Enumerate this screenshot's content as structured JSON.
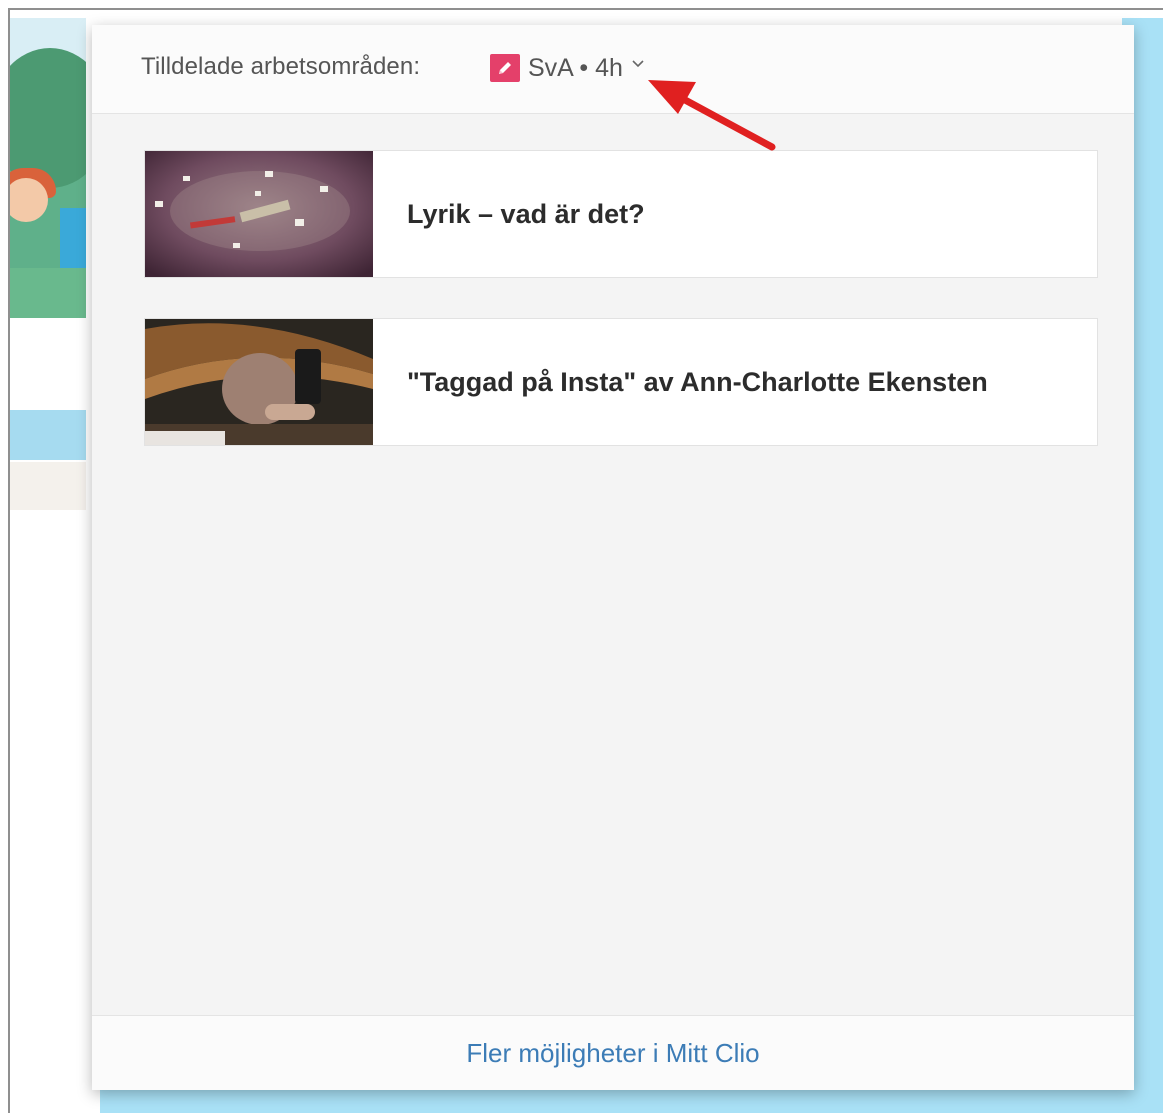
{
  "header": {
    "label": "Tilldelade arbetsområden:",
    "selector_text": "SvA • 4h",
    "selector_icon": "pencil-icon",
    "selector_icon_color": "#e4406a"
  },
  "cards": [
    {
      "title": "Lyrik – vad är det?"
    },
    {
      "title": "\"Taggad på Insta\" av Ann-Charlotte Ekensten"
    }
  ],
  "footer": {
    "link": "Fler möjligheter i Mitt Clio"
  },
  "annotation": {
    "arrow_color": "#e02020"
  }
}
